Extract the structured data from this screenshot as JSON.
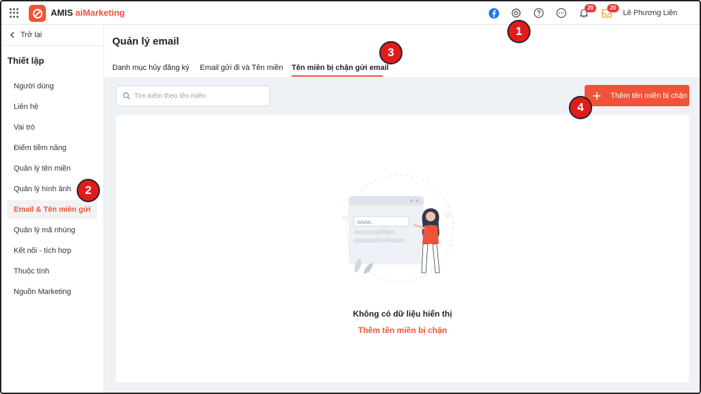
{
  "app": {
    "brand_prefix": "AMIS ",
    "brand_accent": "aiMarketing",
    "user_name": "Lê Phương Liên",
    "notification_count": "20",
    "inbox_count": "20",
    "colors": {
      "accent": "#f0533a",
      "badge": "#e53935",
      "facebook": "#1877f2",
      "callout": "#e11b1b"
    }
  },
  "sidebar": {
    "back_label": "Trở lại",
    "title": "Thiết lập",
    "items": [
      {
        "label": "Người dùng"
      },
      {
        "label": "Liên hệ"
      },
      {
        "label": "Vai trò"
      },
      {
        "label": "Điểm tiềm năng"
      },
      {
        "label": "Quản lý tên miền"
      },
      {
        "label": "Quản lý hình ảnh"
      },
      {
        "label": "Email & Tên miền gửi",
        "active": true
      },
      {
        "label": "Quản lý mã nhúng"
      },
      {
        "label": "Kết nối - tích hợp"
      },
      {
        "label": "Thuộc tính"
      },
      {
        "label": "Nguồn Marketing"
      }
    ]
  },
  "main": {
    "title": "Quản lý email",
    "tabs": [
      {
        "label": "Danh mục hủy đăng ký"
      },
      {
        "label": "Email gửi đi và Tên miền"
      },
      {
        "label": "Tên miền bị chặn gửi email",
        "active": true
      }
    ],
    "search": {
      "placeholder": "Tìm kiếm theo tên miền",
      "value": ""
    },
    "add_button_label": "Thêm tên miền bị chặn",
    "empty_state": {
      "illustration_text": "www.",
      "message": "Không có dữ liệu hiển thị",
      "action_label": "Thêm tên miền bị chặn"
    }
  },
  "callouts": [
    "1",
    "2",
    "3",
    "4"
  ]
}
